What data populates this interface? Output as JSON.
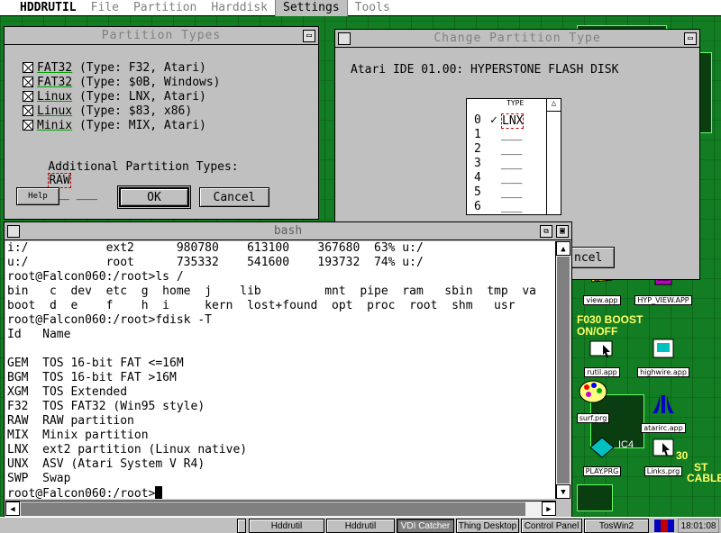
{
  "menubar": {
    "app_name": "HDDRUTIL",
    "items": [
      "File",
      "Partition",
      "Harddisk",
      "Settings",
      "Tools"
    ]
  },
  "partition_types": {
    "title": "Partition Types",
    "options": [
      {
        "name": "FAT32",
        "desc": " (Type: F32, Atari)"
      },
      {
        "name": "FAT32",
        "desc": " (Type: $0B, Windows)"
      },
      {
        "name": "Linux",
        "desc": " (Type: LNX, Atari)"
      },
      {
        "name": "Linux",
        "desc": " (Type: $83, x86)"
      },
      {
        "name": "Minix",
        "desc": " (Type: MIX, Atari)"
      }
    ],
    "additional_label": "Additional Partition Types:",
    "additional_value": "RAW",
    "additional_blanks": "___ ___",
    "help_label": "Help",
    "ok_label": "OK",
    "cancel_label": "Cancel"
  },
  "change_type": {
    "title": "Change Partition Type",
    "disk_label": "Atari IDE 01.00: HYPERSTONE FLASH DISK",
    "list_header": "TYPE",
    "rows": [
      {
        "num": "0",
        "val": "LNX",
        "check": "✓"
      },
      {
        "num": "1",
        "val": "___",
        "check": ""
      },
      {
        "num": "2",
        "val": "___",
        "check": ""
      },
      {
        "num": "3",
        "val": "___",
        "check": ""
      },
      {
        "num": "4",
        "val": "___",
        "check": ""
      },
      {
        "num": "5",
        "val": "___",
        "check": ""
      },
      {
        "num": "6",
        "val": "___",
        "check": ""
      },
      {
        "num": "7",
        "val": "",
        "check": ""
      }
    ],
    "cancel_label": "ncel"
  },
  "bash": {
    "title": "bash",
    "lines": [
      "i:/           ext2      980780    613100    367680  63% u:/",
      "u:/           root      735332    541600    193732  74% u:/",
      "root@Falcon060:/root>ls /",
      "bin   c  dev  etc  g  home  j    lib         mnt  pipe  ram   sbin  tmp  va",
      "boot  d  e    f    h  i     kern  lost+found  opt  proc  root  shm   usr",
      "root@Falcon060:/root>fdisk -T",
      "Id   Name",
      "",
      "GEM  TOS 16-bit FAT <=16M",
      "BGM  TOS 16-bit FAT >16M",
      "XGM  TOS Extended",
      "F32  TOS FAT32 (Win95 style)",
      "RAW  RAW partition",
      "MIX  Minix partition",
      "LNX  ext2 partition (Linux native)",
      "UNX  ASV (Atari System V R4)",
      "SWP  Swap"
    ],
    "prompt": "root@Falcon060:/root>"
  },
  "desktop_icons": [
    {
      "label": "view.app"
    },
    {
      "label": "HYP_VIEW.APP"
    },
    {
      "label": "rutil.app"
    },
    {
      "label": "highwire.app"
    },
    {
      "label": "surf.prg"
    },
    {
      "label": "atarirc.app"
    },
    {
      "label": "PLAY.PRG"
    },
    {
      "label": "Links.prg"
    }
  ],
  "board_text": {
    "boost": "F030 BOOST",
    "onoff": "ON/OFF",
    "ic4": "IC4",
    "cable": "CABLE",
    "num30": "30",
    "st": "ST"
  },
  "taskbar": {
    "tasks": [
      "Hddrutil",
      "Hddrutil",
      "VDI Catcher",
      "Thing Desktop",
      "Control Panel",
      "TosWin2"
    ],
    "clock": "18:01:08"
  }
}
